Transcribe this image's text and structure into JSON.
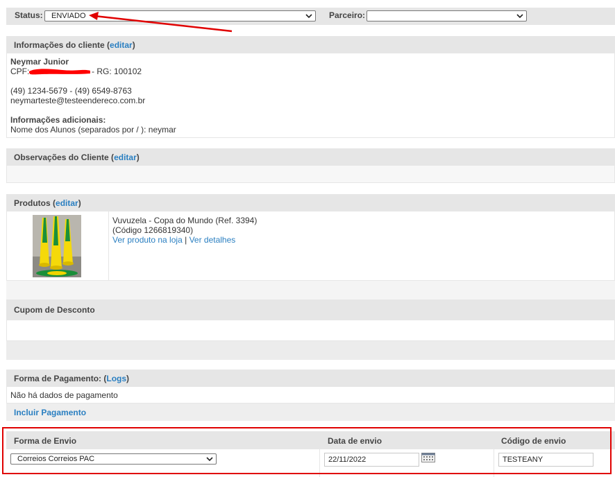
{
  "status_bar": {
    "status_label": "Status:",
    "status_value": "ENVIADO",
    "partner_label": "Parceiro:",
    "partner_value": ""
  },
  "client_info": {
    "title": "Informações do cliente",
    "edit_label": "editar",
    "name": "Neymar Junior",
    "cpf_label": "CPF:",
    "rg_text": "- RG: 100102",
    "phones": "(49) 1234-5679 - (49) 6549-8763",
    "email": "neymarteste@testeendereco.com.br",
    "additional_title": "Informações adicionais:",
    "additional_text": "Nome dos Alunos (separados por / ): neymar"
  },
  "client_notes": {
    "title": "Observações do Cliente",
    "edit_label": "editar"
  },
  "products": {
    "title": "Produtos",
    "edit_label": "editar",
    "items": [
      {
        "name": "Vuvuzela - Copa do Mundo (Ref. 3394)",
        "code": "(Código 1266819340)",
        "view_store_label": "Ver produto na loja",
        "separator": "|",
        "details_label": "Ver detalhes"
      }
    ]
  },
  "coupon": {
    "title": "Cupom de Desconto"
  },
  "payment": {
    "title": "Forma de Pagamento:",
    "logs_label": "Logs",
    "no_data": "Não há dados de pagamento",
    "add_label": "Incluir Pagamento"
  },
  "shipping": {
    "method_header": "Forma de Envio",
    "date_header": "Data de envio",
    "code_header": "Código de envio",
    "method_value": "Correios Correios PAC",
    "date_value": "22/11/2022",
    "code_value": "TESTEANY"
  },
  "colors": {
    "link": "#2a7fc1",
    "annotation_red": "#e00000",
    "header_bg": "#e6e6e6"
  }
}
